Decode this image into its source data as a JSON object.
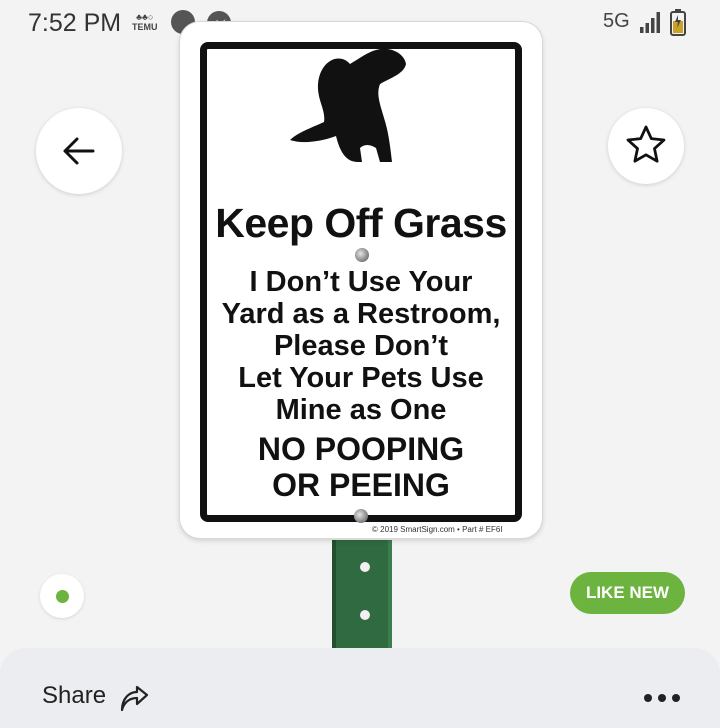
{
  "status_bar": {
    "time": "7:52 PM",
    "app_badge_lines": [
      "♣♣○",
      "TEMU"
    ],
    "network": "5G",
    "icons": [
      "temu-icon",
      "dot-icon",
      "messenger-icon",
      "signal-icon",
      "battery-icon"
    ]
  },
  "product": {
    "sign": {
      "title": "Keep Off Grass",
      "body_lines": [
        "I Don’t Use Your",
        "Yard as a Restroom,",
        "Please Don’t",
        "Let Your Pets Use",
        "Mine as One"
      ],
      "warning_lines": [
        "NO POOPING",
        "OR PEEING"
      ],
      "copyright": "© 2019  SmartSign.com  •  Part # EF6I"
    },
    "condition_badge": "LIKE NEW"
  },
  "nav": {
    "back_icon": "arrow-left-icon",
    "favorite_icon": "star-icon"
  },
  "bottom_sheet": {
    "share_label": "Share",
    "share_icon": "share-arrow-icon",
    "more_icon": "more-dots-icon"
  },
  "colors": {
    "accent_green": "#6cb33f",
    "post_green": "#2f6a41",
    "sign_black": "#111111"
  }
}
